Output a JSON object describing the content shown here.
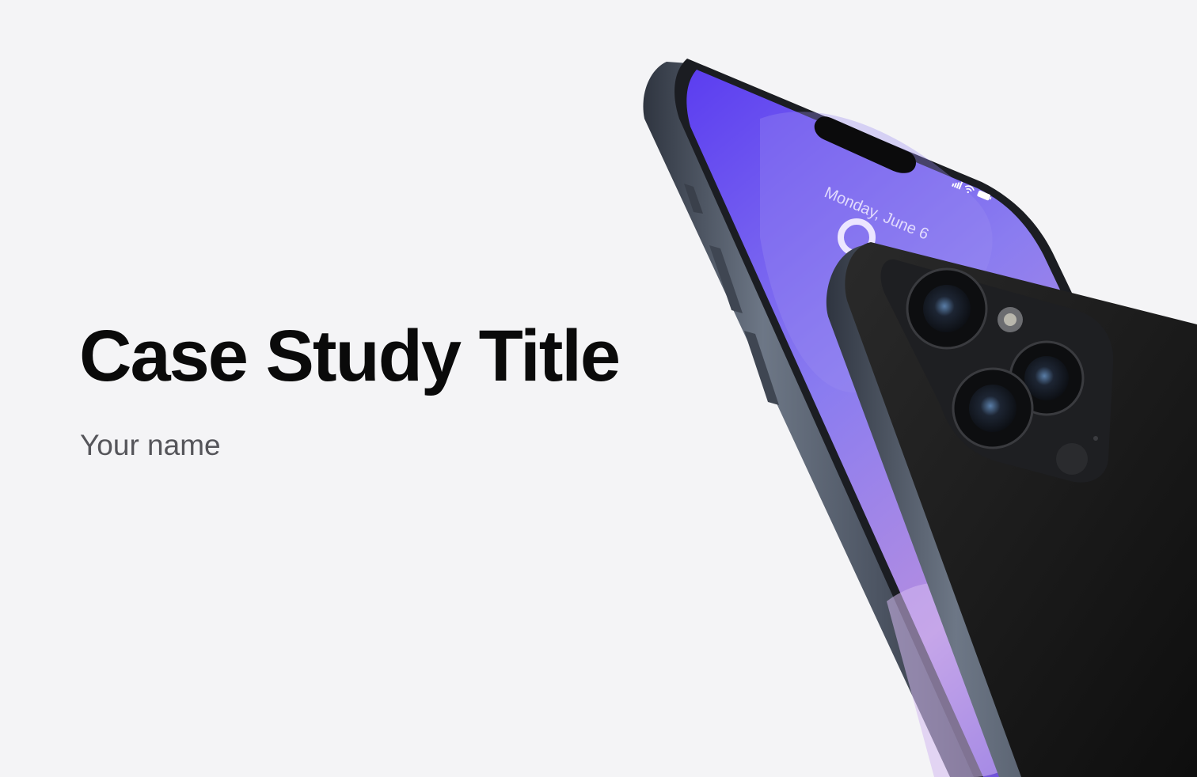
{
  "hero": {
    "title": "Case Study Title",
    "subtitle": "Your name"
  },
  "device_mockup": {
    "lock_screen_date": "Monday, June 6",
    "status_icons": [
      "cellular-signal-icon",
      "wifi-icon",
      "battery-icon"
    ],
    "screen_gradient": [
      "#5b3df0",
      "#8a7cf0",
      "#b58ee0"
    ],
    "frame_color": "#4a5260",
    "back_color": "#151515"
  },
  "colors": {
    "background": "#f4f4f6",
    "title": "#0a0a0a",
    "subtitle": "#55555a"
  }
}
